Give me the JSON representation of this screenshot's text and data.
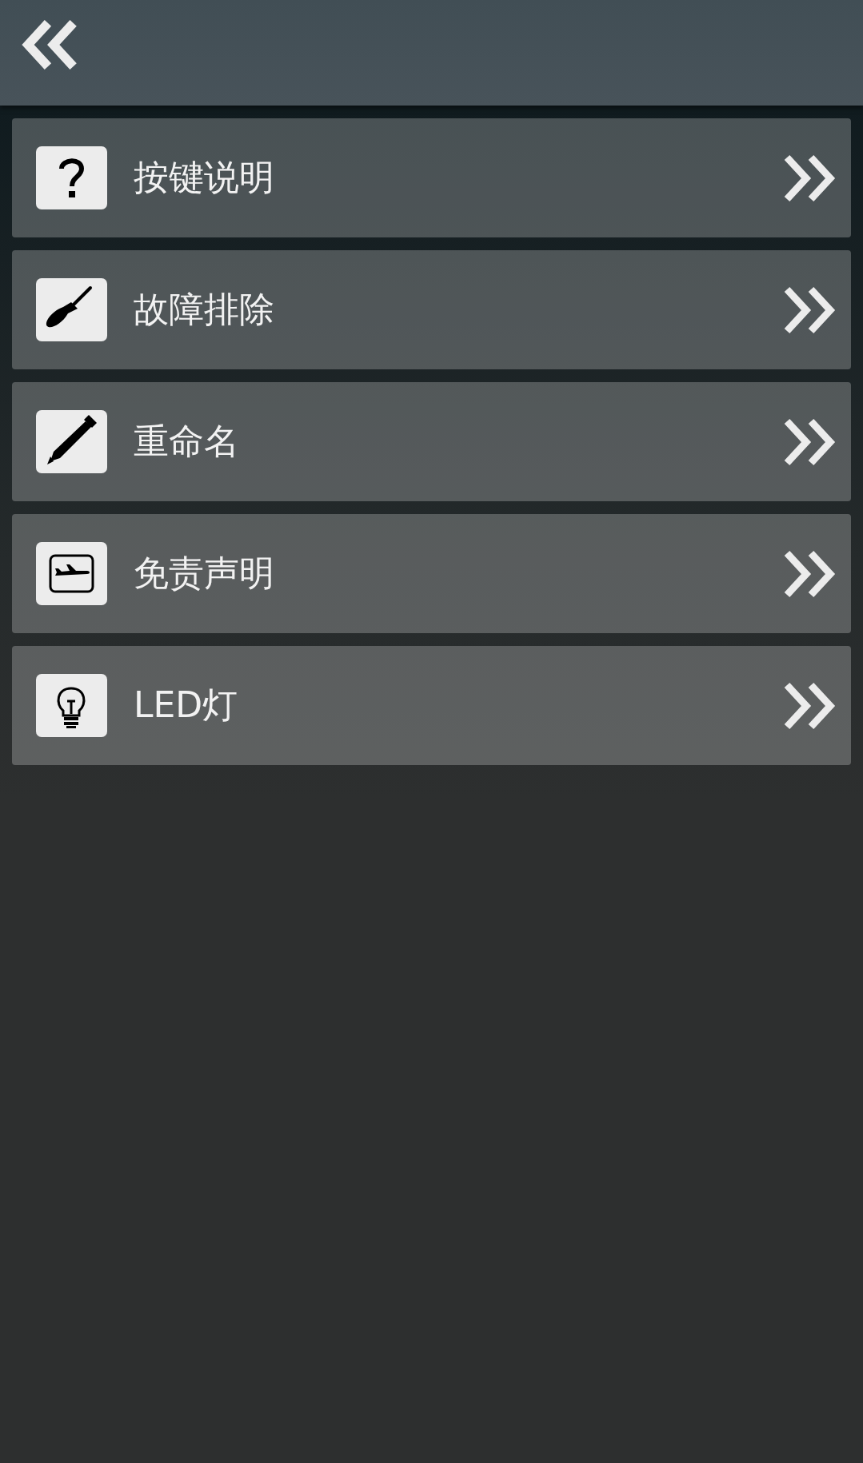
{
  "menu": [
    {
      "label": "按键说明"
    },
    {
      "label": "故障排除"
    },
    {
      "label": "重命名"
    },
    {
      "label": "免责声明"
    },
    {
      "label": "LED灯"
    }
  ]
}
